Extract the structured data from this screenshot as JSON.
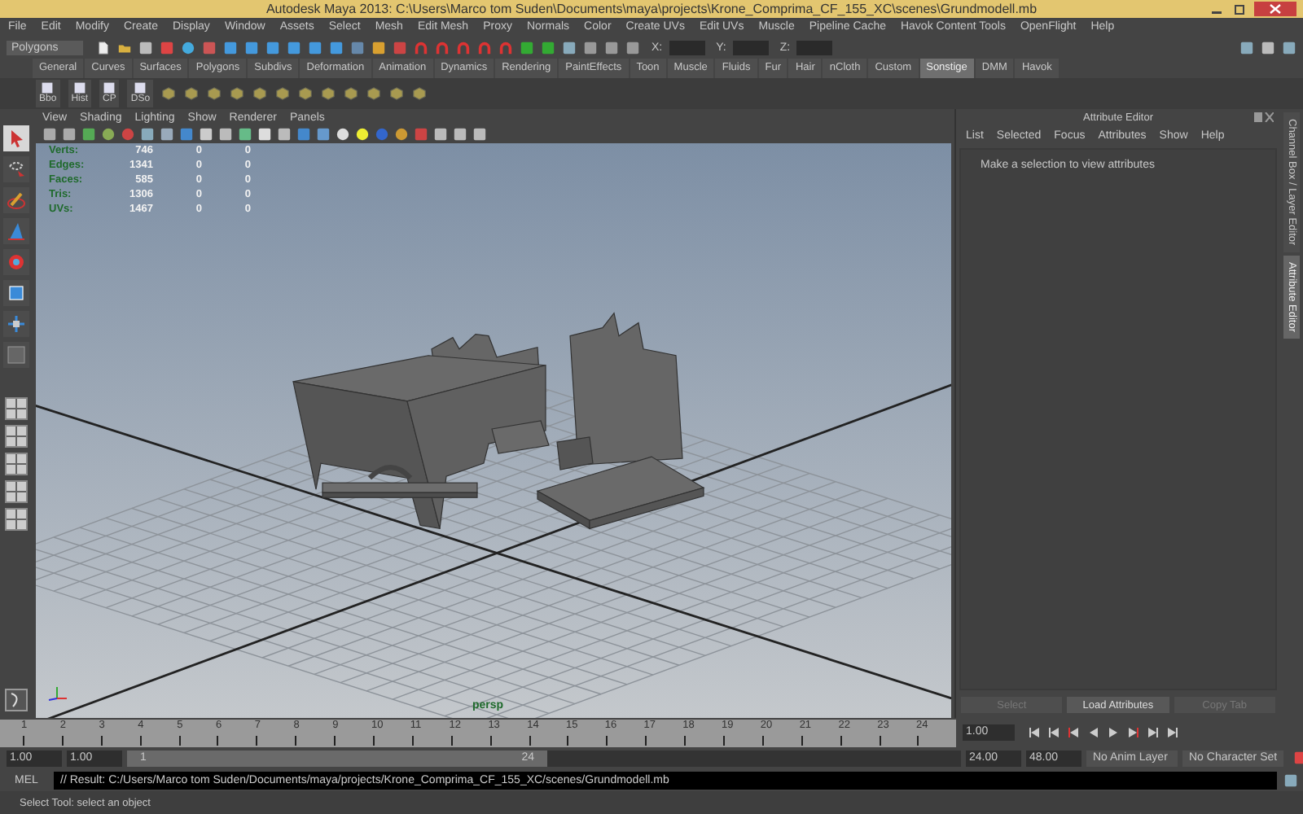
{
  "title_bar": {
    "title": "Autodesk Maya 2013: C:\\Users\\Marco tom Suden\\Documents\\maya\\projects\\Krone_Comprima_CF_155_XC\\scenes\\Grundmodell.mb"
  },
  "menu_bar": [
    "File",
    "Edit",
    "Modify",
    "Create",
    "Display",
    "Window",
    "Assets",
    "Select",
    "Mesh",
    "Edit Mesh",
    "Proxy",
    "Normals",
    "Color",
    "Create UVs",
    "Edit UVs",
    "Muscle",
    "Pipeline Cache",
    "Havok Content Tools",
    "OpenFlight",
    "Help"
  ],
  "status_line": {
    "mode_menu": "Polygons",
    "coord_labels": [
      "X:",
      "Y:",
      "Z:"
    ]
  },
  "shelf": {
    "tabs": [
      {
        "label": "General",
        "selected": false
      },
      {
        "label": "Curves",
        "selected": false
      },
      {
        "label": "Surfaces",
        "selected": false
      },
      {
        "label": "Polygons",
        "selected": false
      },
      {
        "label": "Subdivs",
        "selected": false
      },
      {
        "label": "Deformation",
        "selected": false
      },
      {
        "label": "Animation",
        "selected": false
      },
      {
        "label": "Dynamics",
        "selected": false
      },
      {
        "label": "Rendering",
        "selected": false
      },
      {
        "label": "PaintEffects",
        "selected": false
      },
      {
        "label": "Toon",
        "selected": false
      },
      {
        "label": "Muscle",
        "selected": false
      },
      {
        "label": "Fluids",
        "selected": false
      },
      {
        "label": "Fur",
        "selected": false
      },
      {
        "label": "Hair",
        "selected": false
      },
      {
        "label": "nCloth",
        "selected": false
      },
      {
        "label": "Custom",
        "selected": false
      },
      {
        "label": "Sonstige",
        "selected": true
      },
      {
        "label": "DMM",
        "selected": false
      },
      {
        "label": "Havok",
        "selected": false
      }
    ],
    "buttons": [
      "Bbo",
      "Hist",
      "CP",
      "DSo"
    ]
  },
  "toolbox": [
    {
      "kind": "select",
      "selected": true
    },
    {
      "kind": "lasso",
      "selected": false
    },
    {
      "kind": "paint",
      "selected": false
    },
    {
      "kind": "move",
      "selected": false
    },
    {
      "kind": "rotate",
      "selected": false
    },
    {
      "kind": "scale",
      "selected": false
    },
    {
      "kind": "manipulator",
      "selected": false
    },
    {
      "kind": "last",
      "selected": false
    }
  ],
  "viewport": {
    "menu": [
      "View",
      "Shading",
      "Lighting",
      "Show",
      "Renderer",
      "Panels"
    ],
    "hud": [
      {
        "label": "Verts:",
        "values": [
          "746",
          "0",
          "0"
        ]
      },
      {
        "label": "Edges:",
        "values": [
          "1341",
          "0",
          "0"
        ]
      },
      {
        "label": "Faces:",
        "values": [
          "585",
          "0",
          "0"
        ]
      },
      {
        "label": "Tris:",
        "values": [
          "1306",
          "0",
          "0"
        ]
      },
      {
        "label": "UVs:",
        "values": [
          "1467",
          "0",
          "0"
        ]
      }
    ],
    "camera": "persp"
  },
  "attribute_editor": {
    "title": "Attribute Editor",
    "menu": [
      "List",
      "Selected",
      "Focus",
      "Attributes",
      "Show",
      "Help"
    ],
    "message": "Make a selection to view attributes",
    "buttons": [
      {
        "label": "Select",
        "disabled": true
      },
      {
        "label": "Load Attributes",
        "disabled": false
      },
      {
        "label": "Copy Tab",
        "disabled": true
      }
    ]
  },
  "side_tabs": [
    {
      "label": "Channel Box / Layer Editor",
      "selected": false
    },
    {
      "label": "Attribute Editor",
      "selected": true
    }
  ],
  "time_slider": {
    "frames": [
      "1",
      "2",
      "3",
      "4",
      "5",
      "6",
      "7",
      "8",
      "9",
      "10",
      "11",
      "12",
      "13",
      "14",
      "15",
      "16",
      "17",
      "18",
      "19",
      "20",
      "21",
      "22",
      "23",
      "24"
    ],
    "current_frame": "1.00"
  },
  "range_slider": {
    "start_time": "1.00",
    "playback_start": "1.00",
    "range_start": "1",
    "range_end": "24",
    "playback_end": "24.00",
    "end_time": "48.00",
    "anim_layer": "No Anim Layer",
    "character_set": "No Character Set"
  },
  "command_line": {
    "label": "MEL",
    "result": "// Result: C:/Users/Marco tom Suden/Documents/maya/projects/Krone_Comprima_CF_155_XC/scenes/Grundmodell.mb"
  },
  "help_line": "Select Tool: select an object"
}
